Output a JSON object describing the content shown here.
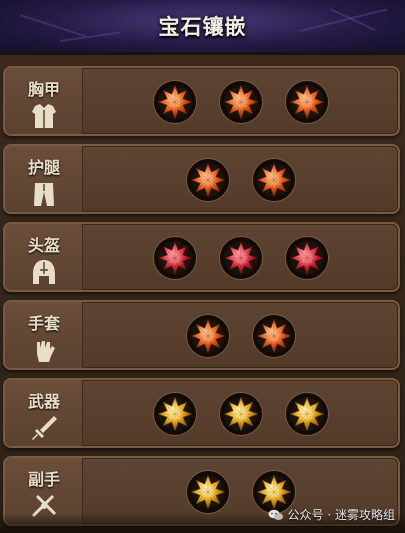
{
  "header": {
    "title": "宝石镶嵌"
  },
  "colors": {
    "orange_gem": "#e8641f",
    "red_gem": "#d8323e",
    "gold_gem": "#e8a820"
  },
  "slots": [
    {
      "label": "胸甲",
      "icon": "chest-armor-icon",
      "gems": [
        "orange",
        "orange",
        "orange"
      ]
    },
    {
      "label": "护腿",
      "icon": "leg-armor-icon",
      "gems": [
        "orange",
        "orange"
      ]
    },
    {
      "label": "头盔",
      "icon": "helmet-icon",
      "gems": [
        "red",
        "red",
        "red"
      ]
    },
    {
      "label": "手套",
      "icon": "glove-icon",
      "gems": [
        "orange",
        "orange"
      ]
    },
    {
      "label": "武器",
      "icon": "weapon-icon",
      "gems": [
        "gold",
        "gold",
        "gold"
      ]
    },
    {
      "label": "副手",
      "icon": "offhand-icon",
      "gems": [
        "gold",
        "gold"
      ]
    }
  ],
  "watermark": {
    "text": "公众号 · 迷雾攻略组",
    "icon": "wechat-icon"
  }
}
